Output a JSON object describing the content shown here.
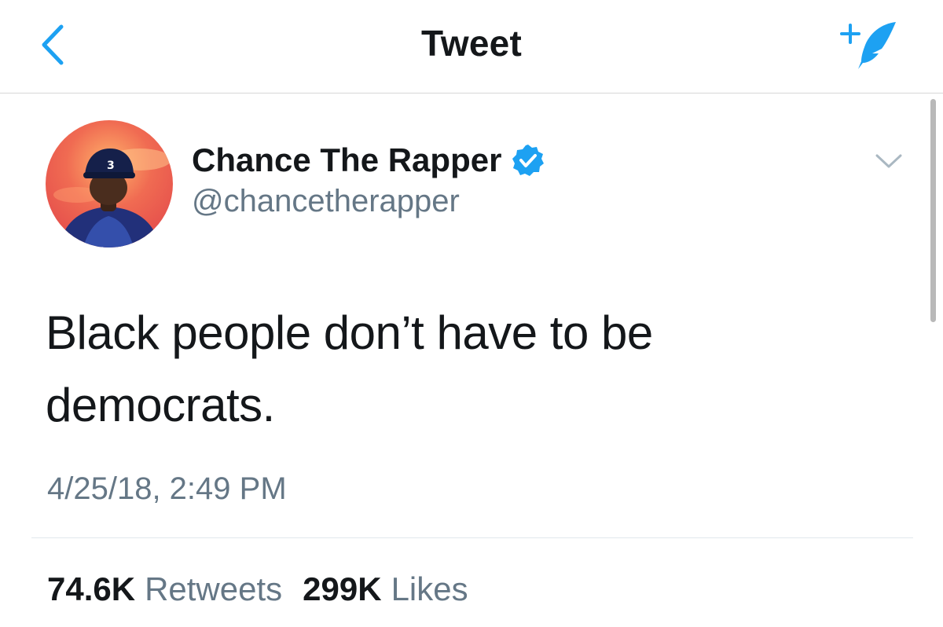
{
  "nav": {
    "title": "Tweet",
    "back_icon": "chevron-left-icon",
    "compose_icon": "compose-tweet-icon"
  },
  "tweet": {
    "author": {
      "display_name": "Chance The Rapper",
      "handle": "@chancetherapper",
      "verified": true,
      "avatar_cap_text": "3"
    },
    "text_line_1": "Black people don’t have to be",
    "text_line_2": "democrats.",
    "timestamp": "4/25/18, 2:49 PM",
    "stats": {
      "retweets_count": "74.6K",
      "retweets_label": "Retweets",
      "likes_count": "299K",
      "likes_label": "Likes"
    }
  },
  "colors": {
    "accent": "#1da1f2",
    "primary_text": "#14171a",
    "secondary_text": "#657786",
    "divider": "#e1e8ed"
  }
}
